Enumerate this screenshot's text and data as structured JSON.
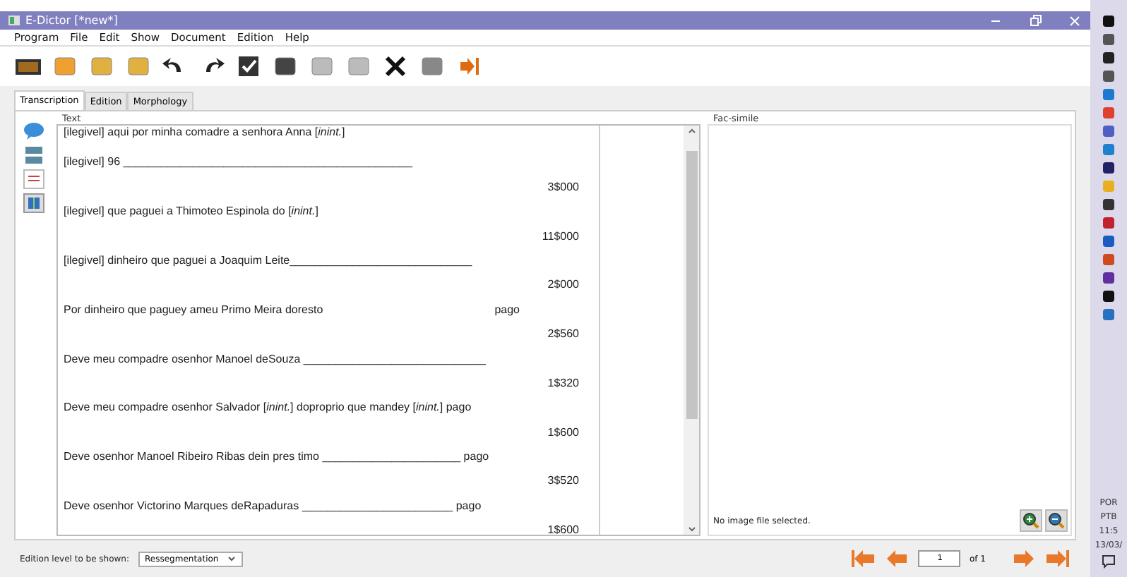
{
  "window": {
    "title": "E-Dictor [*new*]"
  },
  "menu": [
    "Program",
    "File",
    "Edit",
    "Show",
    "Document",
    "Edition",
    "Help"
  ],
  "tabs": [
    {
      "label": "Transcription",
      "selected": true
    },
    {
      "label": "Edition",
      "selected": false
    },
    {
      "label": "Morphology",
      "selected": false
    }
  ],
  "text_panel": {
    "label": "Text",
    "lines": [
      {
        "kind": "text",
        "text": "[ilegivel] aqui por minha comadre a senhora Anna  [*inint.*]"
      },
      {
        "kind": "text",
        "text": "[ilegivel] 96 ______________________________________________"
      },
      {
        "kind": "amount",
        "text": "3$000"
      },
      {
        "kind": "text",
        "text": "[ilegivel] que paguei a Thimoteo Espinola do [*inint.*]"
      },
      {
        "kind": "amount",
        "text": "11$000"
      },
      {
        "kind": "text",
        "text": "[ilegivel] dinheiro que paguei a Joaquim Leite_____________________________"
      },
      {
        "kind": "amount",
        "text": "2$000"
      },
      {
        "kind": "text",
        "text": "Por dinheiro que paguey ameu Primo Meira doresto",
        "aside": "pago"
      },
      {
        "kind": "amount",
        "text": "2$560"
      },
      {
        "kind": "text",
        "text": "Deve meu compadre osenhor Manoel deSouza _____________________________"
      },
      {
        "kind": "amount",
        "text": "1$320"
      },
      {
        "kind": "text",
        "text": "Deve meu compadre osenhor Salvador [*inint.*] doproprio que mandey [*inint.*] pago"
      },
      {
        "kind": "amount",
        "text": "1$600"
      },
      {
        "kind": "text",
        "text": "Deve osenhor Manoel Ribeiro Ribas dein pres timo ______________________  pago"
      },
      {
        "kind": "amount",
        "text": "3$520"
      },
      {
        "kind": "text",
        "text": "Deve osenhor Victorino Marques deRapaduras ________________________ pago"
      },
      {
        "kind": "amount",
        "text": "1$600"
      }
    ]
  },
  "facsimile": {
    "label": "Fac-simile",
    "status": "No image file selected."
  },
  "bottom": {
    "edition_label": "Edition level to be shown:",
    "edition_value": "Ressegmentation",
    "page": "1",
    "page_total": "of 1"
  },
  "taskbar": {
    "language": "POR",
    "layout": "PTB",
    "time": "11:5",
    "date": "13/03/"
  }
}
